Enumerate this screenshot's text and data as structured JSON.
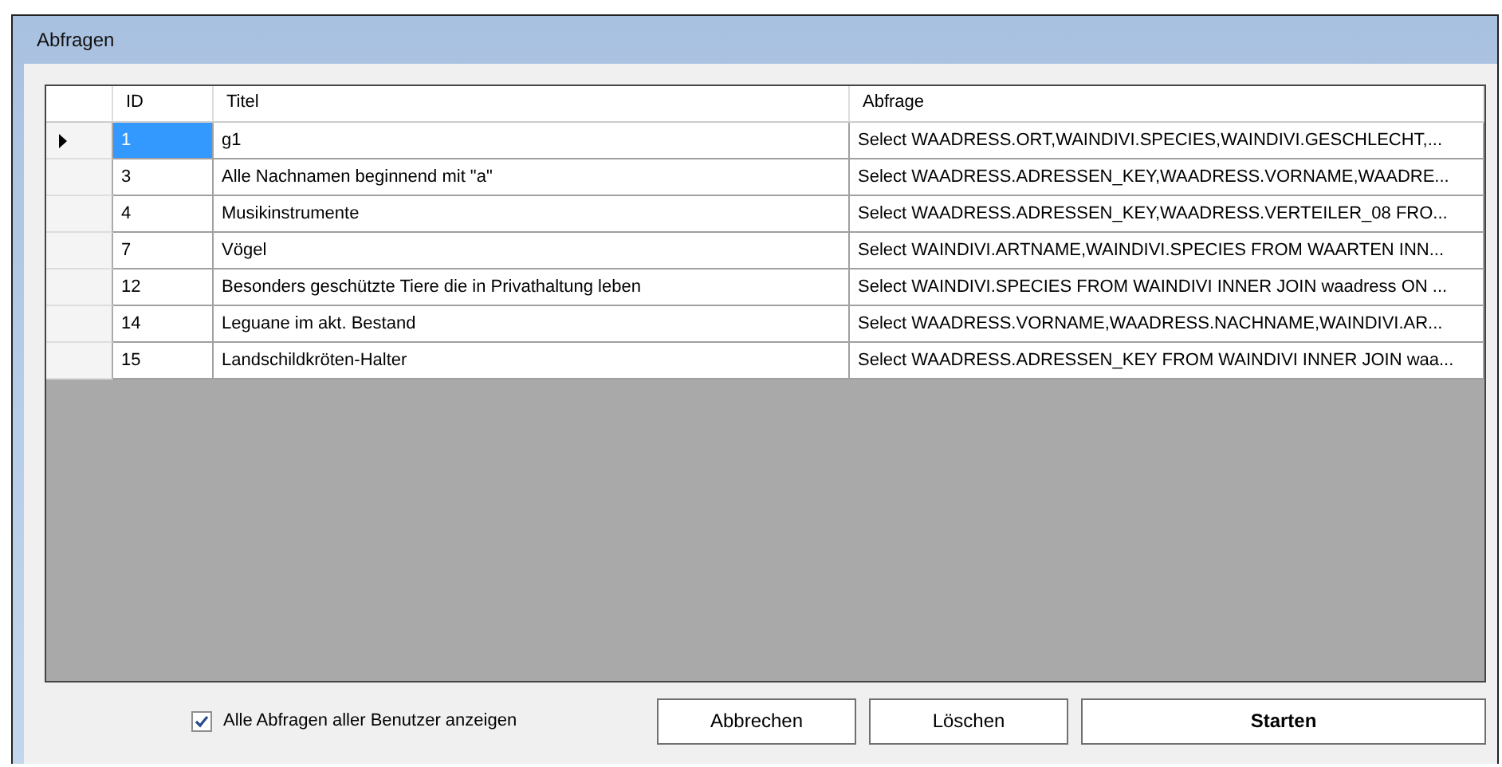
{
  "window": {
    "title": "Abfragen"
  },
  "table": {
    "columns": [
      "ID",
      "Titel",
      "Abfrage"
    ],
    "rows": [
      {
        "id": "1",
        "titel": "g1",
        "abfrage": "Select WAADRESS.ORT,WAINDIVI.SPECIES,WAINDIVI.GESCHLECHT,...",
        "selected": true
      },
      {
        "id": "3",
        "titel": "Alle Nachnamen beginnend mit \"a\"",
        "abfrage": "Select WAADRESS.ADRESSEN_KEY,WAADRESS.VORNAME,WAADRE...",
        "selected": false
      },
      {
        "id": "4",
        "titel": "Musikinstrumente",
        "abfrage": "Select WAADRESS.ADRESSEN_KEY,WAADRESS.VERTEILER_08 FRO...",
        "selected": false
      },
      {
        "id": "7",
        "titel": "Vögel",
        "abfrage": "Select WAINDIVI.ARTNAME,WAINDIVI.SPECIES FROM WAARTEN INN...",
        "selected": false
      },
      {
        "id": "12",
        "titel": "Besonders geschützte Tiere die in Privathaltung leben",
        "abfrage": "Select WAINDIVI.SPECIES FROM WAINDIVI INNER JOIN waadress ON ...",
        "selected": false
      },
      {
        "id": "14",
        "titel": "Leguane im akt. Bestand",
        "abfrage": "Select WAADRESS.VORNAME,WAADRESS.NACHNAME,WAINDIVI.AR...",
        "selected": false
      },
      {
        "id": "15",
        "titel": "Landschildkröten-Halter",
        "abfrage": "Select WAADRESS.ADRESSEN_KEY FROM WAINDIVI INNER JOIN waa...",
        "selected": false
      }
    ]
  },
  "show_all": {
    "label": "Alle Abfragen aller Benutzer anzeigen",
    "checked": true
  },
  "buttons": [
    {
      "label": "Abbrechen",
      "kind": "normal"
    },
    {
      "label": "Löschen",
      "kind": "normal"
    },
    {
      "label": "Starten",
      "kind": "primary"
    }
  ]
}
